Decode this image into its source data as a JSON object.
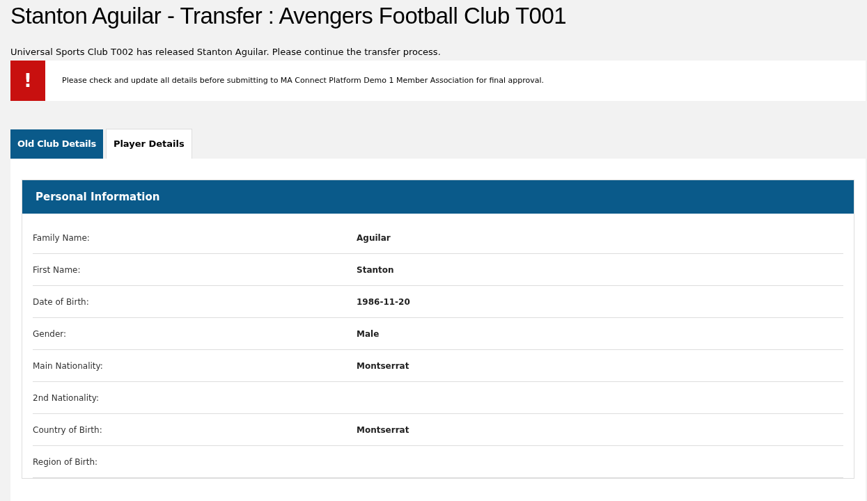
{
  "title": "Stanton Aguilar - Transfer : Avengers Football Club T001",
  "message": "Universal Sports Club T002 has released Stanton Aguilar. Please continue the transfer process.",
  "alert": {
    "icon": "!",
    "text": "Please check and update all details before submitting to MA Connect Platform Demo 1 Member Association for final approval."
  },
  "tabs": [
    {
      "label": "Old Club Details",
      "selected": false
    },
    {
      "label": "Player Details",
      "selected": true
    }
  ],
  "section": {
    "title": "Personal Information",
    "rows": [
      {
        "label": "Family Name:",
        "value": "Aguilar"
      },
      {
        "label": "First Name:",
        "value": "Stanton"
      },
      {
        "label": "Date of Birth:",
        "value": "1986-11-20"
      },
      {
        "label": "Gender:",
        "value": "Male"
      },
      {
        "label": "Main Nationality:",
        "value": "Montserrat"
      },
      {
        "label": "2nd Nationality:"
      },
      {
        "label": "Country of Birth:",
        "value": "Montserrat"
      },
      {
        "label": "Region of Birth:"
      }
    ]
  }
}
